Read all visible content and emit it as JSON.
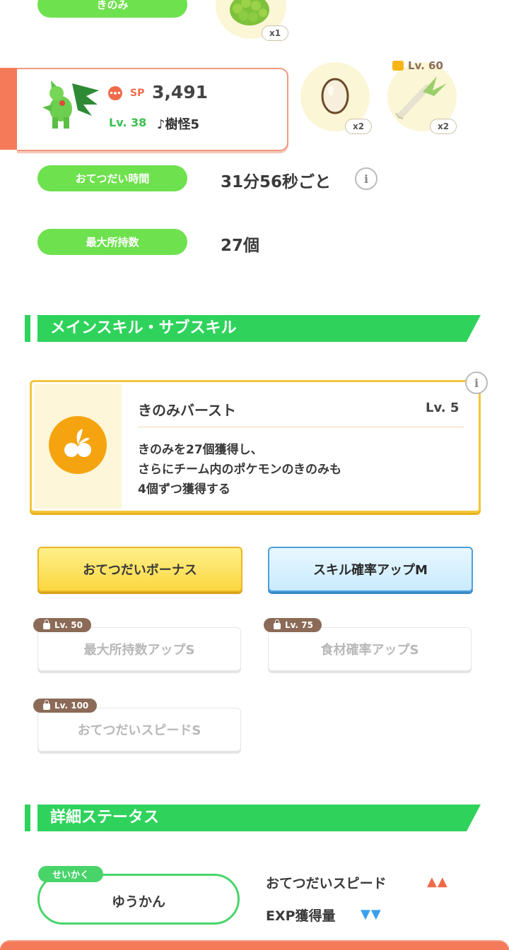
{
  "top": {
    "berry_label": "きのみ",
    "berry_qty": "x1"
  },
  "pokemon_card": {
    "sp_label": "SP",
    "sp_value": "3,491",
    "level": "Lv. 38",
    "nickname": "♪樹怪5"
  },
  "ingredients": [
    {
      "qty": "x2",
      "icon": "egg-icon"
    },
    {
      "qty": "x2",
      "icon": "leek-icon",
      "lock_level": "Lv. 60"
    }
  ],
  "stats_rows": {
    "help_time_label": "おてつだい時間",
    "help_time_value": "31分56秒ごと",
    "max_carry_label": "最大所持数",
    "max_carry_value": "27個"
  },
  "skills_section": {
    "title": "メインスキル・サブスキル",
    "main_skill": {
      "name": "きのみバースト",
      "level": "Lv. 5",
      "desc_lines": [
        "きのみを27個獲得し、",
        "さらにチーム内のポケモンのきのみも",
        "4個ずつ獲得する"
      ]
    },
    "sub_skills": [
      {
        "label": "おてつだいボーナス"
      },
      {
        "label": "スキル確率アップM"
      },
      {
        "label": "最大所持数アップS",
        "lock": "Lv. 50"
      },
      {
        "label": "食材確率アップS",
        "lock": "Lv. 75"
      },
      {
        "label": "おてつだいスピードS",
        "lock": "Lv. 100"
      }
    ]
  },
  "detail_section": {
    "title": "詳細ステータス",
    "nature_tag": "せいかく",
    "nature_value": "ゆうかん",
    "up_label": "おてつだいスピード",
    "up_marks": "▲▲",
    "down_label": "EXP獲得量",
    "down_marks": "▼▼"
  },
  "colors": {
    "green": "#2fd35c",
    "pill_green": "#6ee14e",
    "skill_orange": "#f5a410",
    "up_red": "#f06a4a",
    "down_blue": "#3aa0ee"
  }
}
